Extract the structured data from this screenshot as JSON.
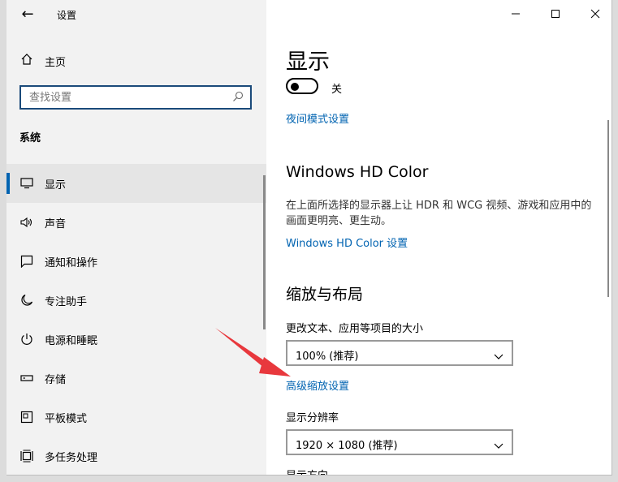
{
  "window": {
    "title": "设置",
    "back_icon": "arrow-left-icon",
    "controls": [
      "minimize-icon",
      "maximize-icon",
      "close-icon"
    ]
  },
  "sidebar": {
    "home_label": "主页",
    "search_placeholder": "查找设置",
    "section_label": "系统",
    "items": [
      {
        "label": "显示",
        "icon": "monitor-icon",
        "active": true
      },
      {
        "label": "声音",
        "icon": "speaker-icon",
        "active": false
      },
      {
        "label": "通知和操作",
        "icon": "notification-icon",
        "active": false
      },
      {
        "label": "专注助手",
        "icon": "moon-icon",
        "active": false
      },
      {
        "label": "电源和睡眠",
        "icon": "power-icon",
        "active": false
      },
      {
        "label": "存储",
        "icon": "storage-icon",
        "active": false
      },
      {
        "label": "平板模式",
        "icon": "tablet-icon",
        "active": false
      },
      {
        "label": "多任务处理",
        "icon": "multitask-icon",
        "active": false
      }
    ]
  },
  "main": {
    "title": "显示",
    "toggle_state": "关",
    "night_link": "夜间模式设置",
    "hd_title": "Windows HD Color",
    "hd_desc": "在上面所选择的显示器上让 HDR 和 WCG 视频、游戏和应用中的画面更明亮、更生动。",
    "hd_link": "Windows HD Color 设置",
    "scale_title": "缩放与布局",
    "scale_label": "更改文本、应用等项目的大小",
    "scale_value": "100% (推荐)",
    "advanced_link": "高级缩放设置",
    "res_label": "显示分辨率",
    "res_value": "1920 × 1080 (推荐)",
    "orient_label": "显示方向"
  },
  "colors": {
    "accent": "#0063b1",
    "annotation_arrow": "#e8383d"
  }
}
